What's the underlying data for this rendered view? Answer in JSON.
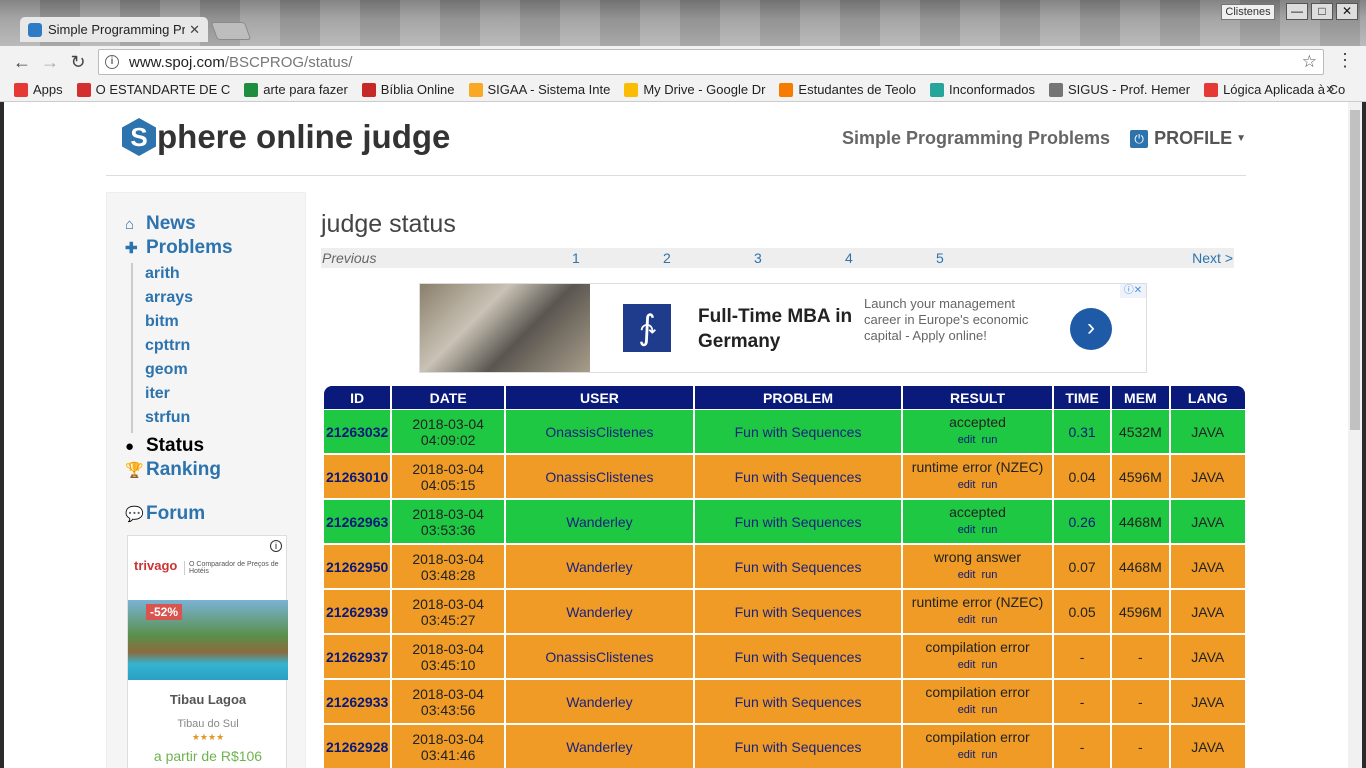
{
  "browser": {
    "tab_title": "Simple Programming Pr",
    "tab_close": "✕",
    "user_badge": "Clistenes",
    "window_controls": {
      "minimize": "—",
      "maximize": "□",
      "close": "✕"
    },
    "url_host": "www.spoj.com",
    "url_path": "/BSCPROG/status/",
    "bookmarks": [
      {
        "label": "Apps",
        "color": "#e53935"
      },
      {
        "label": "O ESTANDARTE DE C",
        "color": "#d32f2f"
      },
      {
        "label": "arte para fazer",
        "color": "#1e8e3e"
      },
      {
        "label": "Bíblia Online",
        "color": "#c62828"
      },
      {
        "label": "SIGAA - Sistema Inte",
        "color": "#f9a825"
      },
      {
        "label": "My Drive - Google Dr",
        "color": "#fbbc04"
      },
      {
        "label": "Estudantes de Teolo",
        "color": "#f57c00"
      },
      {
        "label": "Inconformados",
        "color": "#26a69a"
      },
      {
        "label": "SIGUS - Prof. Hemer",
        "color": "#757575"
      },
      {
        "label": "Lógica Aplicada à Co",
        "color": "#e53935"
      }
    ],
    "bookmarks_more": "»"
  },
  "site": {
    "logo_letter": "S",
    "logo_text": "phere online judge",
    "subtitle": "Simple Programming Problems",
    "profile_label": "PROFILE"
  },
  "sidebar": {
    "news": "News",
    "problems": "Problems",
    "sub_items": [
      "arith",
      "arrays",
      "bitm",
      "cpttrn",
      "geom",
      "iter",
      "strfun"
    ],
    "status": "Status",
    "ranking": "Ranking",
    "forum": "Forum",
    "ad": {
      "brand": "trivago",
      "tagline": "O Comparador de Preços de Hotéis",
      "discount": "-52%",
      "hotel": "Tibau Lagoa",
      "place": "Tibau do Sul",
      "stars": "★★★★",
      "price": "a partir de R$106"
    }
  },
  "main": {
    "title": "judge status",
    "pager": {
      "previous": "Previous",
      "pages": [
        "1",
        "2",
        "3",
        "4",
        "5"
      ],
      "next": "Next >"
    },
    "ad": {
      "headline": "Full-Time MBA in Germany",
      "description": "Launch your management career in Europe's economic capital - Apply online!",
      "go": "›",
      "adchoices": "ⓘ✕"
    },
    "table": {
      "headers": [
        "ID",
        "DATE",
        "USER",
        "PROBLEM",
        "RESULT",
        "TIME",
        "MEM",
        "LANG"
      ],
      "edit_label": "edit",
      "run_label": "run",
      "rows": [
        {
          "id": "21263032",
          "date": "2018-03-04 04:09:02",
          "user": "OnassisClistenes",
          "problem": "Fun with Sequences",
          "result": "accepted",
          "time": "0.31",
          "mem": "4532M",
          "lang": "JAVA",
          "status": "ok"
        },
        {
          "id": "21263010",
          "date": "2018-03-04 04:05:15",
          "user": "OnassisClistenes",
          "problem": "Fun with Sequences",
          "result": "runtime error (NZEC)",
          "time": "0.04",
          "mem": "4596M",
          "lang": "JAVA",
          "status": "bad"
        },
        {
          "id": "21262963",
          "date": "2018-03-04 03:53:36",
          "user": "Wanderley",
          "problem": "Fun with Sequences",
          "result": "accepted",
          "time": "0.26",
          "mem": "4468M",
          "lang": "JAVA",
          "status": "ok"
        },
        {
          "id": "21262950",
          "date": "2018-03-04 03:48:28",
          "user": "Wanderley",
          "problem": "Fun with Sequences",
          "result": "wrong answer",
          "time": "0.07",
          "mem": "4468M",
          "lang": "JAVA",
          "status": "bad"
        },
        {
          "id": "21262939",
          "date": "2018-03-04 03:45:27",
          "user": "Wanderley",
          "problem": "Fun with Sequences",
          "result": "runtime error (NZEC)",
          "time": "0.05",
          "mem": "4596M",
          "lang": "JAVA",
          "status": "bad"
        },
        {
          "id": "21262937",
          "date": "2018-03-04 03:45:10",
          "user": "OnassisClistenes",
          "problem": "Fun with Sequences",
          "result": "compilation error",
          "time": "-",
          "mem": "-",
          "lang": "JAVA",
          "status": "bad"
        },
        {
          "id": "21262933",
          "date": "2018-03-04 03:43:56",
          "user": "Wanderley",
          "problem": "Fun with Sequences",
          "result": "compilation error",
          "time": "-",
          "mem": "-",
          "lang": "JAVA",
          "status": "bad"
        },
        {
          "id": "21262928",
          "date": "2018-03-04 03:41:46",
          "user": "Wanderley",
          "problem": "Fun with Sequences",
          "result": "compilation error",
          "time": "-",
          "mem": "-",
          "lang": "JAVA",
          "status": "bad"
        }
      ]
    }
  },
  "colors": {
    "accepted": "#1ec843",
    "error": "#ef9b25",
    "header": "#0a1a7a",
    "link": "#2d73ad"
  }
}
